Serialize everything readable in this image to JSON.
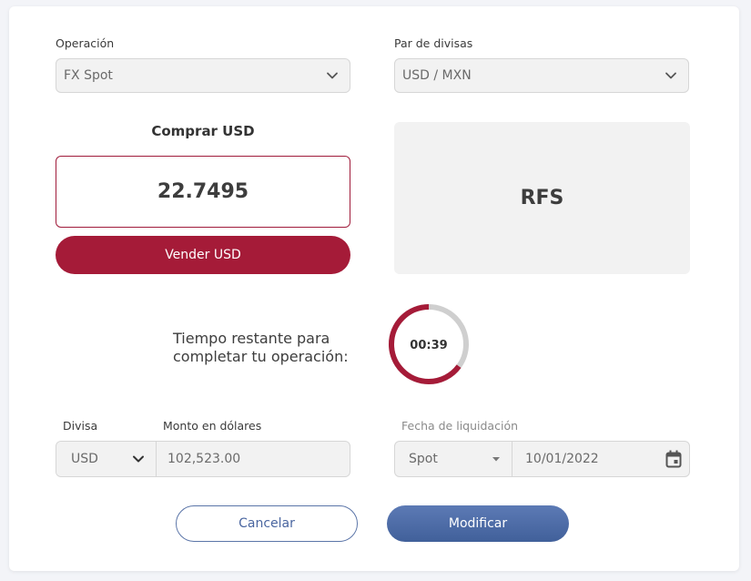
{
  "operation": {
    "label": "Operación",
    "value": "FX Spot"
  },
  "pair": {
    "label": "Par de divisas",
    "value": "USD / MXN"
  },
  "buy": {
    "title": "Comprar USD",
    "price": "22.7495"
  },
  "sell": {
    "label": "Vender USD"
  },
  "rfs": {
    "text": "RFS"
  },
  "timer": {
    "line1": "Tiempo restante para",
    "line2": "completar tu operación:",
    "time": "00:39",
    "remaining_fraction": 0.65
  },
  "currency": {
    "label": "Divisa",
    "value": "USD"
  },
  "amount": {
    "label": "Monto en dólares",
    "value": "102,523.00"
  },
  "settlement": {
    "label": "Fecha de liquidación",
    "type": "Spot",
    "date": "10/01/2022"
  },
  "actions": {
    "cancel": "Cancelar",
    "modify": "Modificar"
  },
  "colors": {
    "accent_red": "#a51b38",
    "accent_blue": "#4a66a0",
    "ring_track": "#cfcfcf"
  }
}
